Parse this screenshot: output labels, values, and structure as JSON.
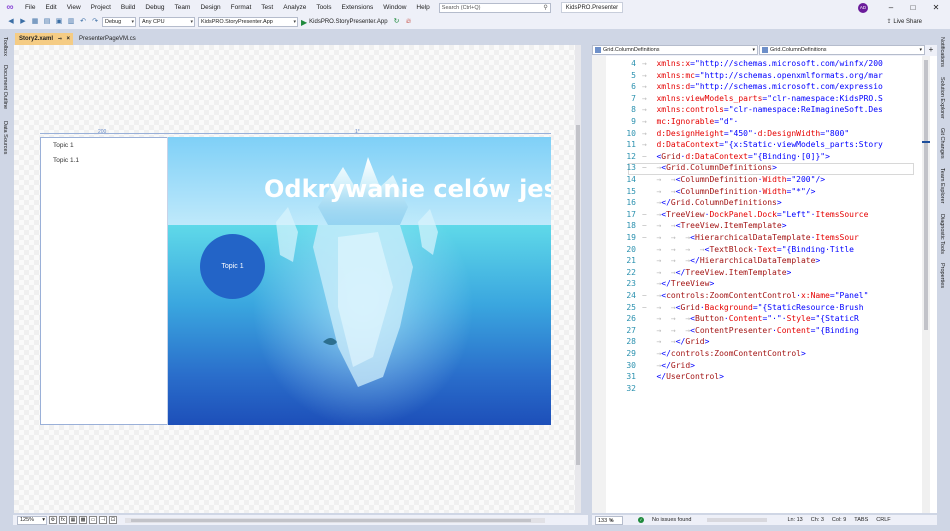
{
  "menu": {
    "items": [
      "File",
      "Edit",
      "View",
      "Project",
      "Build",
      "Debug",
      "Team",
      "Design",
      "Format",
      "Test",
      "Analyze",
      "Tools",
      "Extensions",
      "Window",
      "Help"
    ],
    "search_placeholder": "Search (Ctrl+Q)",
    "app_title": "KidsPRO.Presenter",
    "avatar_initials": "AD"
  },
  "toolbar": {
    "config": "Debug",
    "platform": "Any CPU",
    "project": "KidsPRO.StoryPresenter.App",
    "run_label": "KidsPRO.StoryPresenter.App",
    "live_share": "Live Share"
  },
  "left_dock": {
    "tabs": [
      "Toolbox",
      "Document Outline",
      "Data Sources"
    ]
  },
  "right_dock": {
    "tabs": [
      "Notifications",
      "Solution Explorer",
      "Git Changes",
      "Team Explorer",
      "Diagnostic Tools",
      "Properties"
    ]
  },
  "tabs": [
    {
      "label": "Story2.xaml",
      "active": true
    },
    {
      "label": "PresenterPageVM.cs",
      "active": false
    }
  ],
  "designer": {
    "ruler_left": "200",
    "ruler_right": "1*",
    "tree_items": [
      "Topic 1",
      "Topic 1.1"
    ],
    "headline": "Odkrywanie celów jest w",
    "circle_label": "Topic 1",
    "zoom": "125%",
    "fx": "fx"
  },
  "editor": {
    "nav_left": "Grid.ColumnDefinitions",
    "nav_right": "Grid.ColumnDefinitions",
    "lines": [
      {
        "n": "4",
        "g": "→  ",
        "parts": [
          [
            "attr",
            "xmlns:x"
          ],
          [
            "pun",
            "=\""
          ],
          [
            "str",
            "http://schemas.microsoft.com/winfx/200"
          ]
        ]
      },
      {
        "n": "5",
        "g": "→  ",
        "parts": [
          [
            "attr",
            "xmlns:mc"
          ],
          [
            "pun",
            "=\""
          ],
          [
            "str",
            "http://schemas.openxmlformats.org/mar"
          ]
        ]
      },
      {
        "n": "6",
        "g": "→  ",
        "parts": [
          [
            "attr",
            "xmlns:d"
          ],
          [
            "pun",
            "=\""
          ],
          [
            "str",
            "http://schemas.microsoft.com/expressio"
          ]
        ]
      },
      {
        "n": "7",
        "g": "→  ",
        "parts": [
          [
            "attr",
            "xmlns:viewModels_parts"
          ],
          [
            "pun",
            "=\""
          ],
          [
            "str",
            "clr-namespace:KidsPRO.S"
          ]
        ]
      },
      {
        "n": "8",
        "g": "→  ",
        "parts": [
          [
            "attr",
            "xmlns:controls"
          ],
          [
            "pun",
            "=\""
          ],
          [
            "str",
            "clr-namespace:ReImagineSoft.Des"
          ]
        ]
      },
      {
        "n": "9",
        "g": "→  ",
        "parts": [
          [
            "attr",
            "mc:Ignorable"
          ],
          [
            "pun",
            "=\""
          ],
          [
            "str",
            "d\""
          ],
          [
            "pun",
            "·"
          ]
        ]
      },
      {
        "n": "10",
        "g": "→  ",
        "parts": [
          [
            "attr",
            "d:DesignHeight"
          ],
          [
            "pun",
            "=\""
          ],
          [
            "str",
            "450\""
          ],
          [
            "pun",
            "·"
          ],
          [
            "attr",
            "d:DesignWidth"
          ],
          [
            "pun",
            "=\""
          ],
          [
            "str",
            "800\""
          ]
        ]
      },
      {
        "n": "11",
        "g": "→  ",
        "parts": [
          [
            "attr",
            "d:DataContext"
          ],
          [
            "pun",
            "=\""
          ],
          [
            "str",
            "{x:Static·viewModels_parts:Story"
          ]
        ]
      },
      {
        "n": "12",
        "g": "−  ",
        "parts": [
          [
            "pun",
            "<"
          ],
          [
            "tag",
            "Grid"
          ],
          [
            "pun",
            "·"
          ],
          [
            "attr",
            "d:DataContext"
          ],
          [
            "pun",
            "=\""
          ],
          [
            "str",
            "{Binding·[0]}"
          ],
          [
            "pun",
            "\">"
          ]
        ]
      },
      {
        "n": "13",
        "g": "−  →",
        "parts": [
          [
            "pun",
            "<"
          ],
          [
            "tag",
            "Grid.ColumnDefinitions"
          ],
          [
            "pun",
            ">"
          ]
        ]
      },
      {
        "n": "14",
        "g": "   →  →",
        "parts": [
          [
            "pun",
            "<"
          ],
          [
            "tag",
            "ColumnDefinition"
          ],
          [
            "pun",
            "·"
          ],
          [
            "attr",
            "Width"
          ],
          [
            "pun",
            "=\""
          ],
          [
            "str",
            "200"
          ],
          [
            "pun",
            "\"/>"
          ]
        ]
      },
      {
        "n": "15",
        "g": "   →  →",
        "parts": [
          [
            "pun",
            "<"
          ],
          [
            "tag",
            "ColumnDefinition"
          ],
          [
            "pun",
            "·"
          ],
          [
            "attr",
            "Width"
          ],
          [
            "pun",
            "=\""
          ],
          [
            "str",
            "*"
          ],
          [
            "pun",
            "\"/>"
          ]
        ]
      },
      {
        "n": "16",
        "g": "   →",
        "parts": [
          [
            "pun",
            "</"
          ],
          [
            "tag",
            "Grid.ColumnDefinitions"
          ],
          [
            "pun",
            ">"
          ]
        ]
      },
      {
        "n": "17",
        "g": "−  →",
        "parts": [
          [
            "pun",
            "<"
          ],
          [
            "tag",
            "TreeView"
          ],
          [
            "pun",
            "·"
          ],
          [
            "attr",
            "DockPanel.Dock"
          ],
          [
            "pun",
            "=\""
          ],
          [
            "str",
            "Left"
          ],
          [
            "pun",
            "\"·"
          ],
          [
            "attr",
            "ItemsSource"
          ]
        ]
      },
      {
        "n": "18",
        "g": "−  →  →",
        "parts": [
          [
            "pun",
            "<"
          ],
          [
            "tag",
            "TreeView.ItemTemplate"
          ],
          [
            "pun",
            ">"
          ]
        ]
      },
      {
        "n": "19",
        "g": "−  →  →  →",
        "parts": [
          [
            "pun",
            "<"
          ],
          [
            "tag",
            "HierarchicalDataTemplate"
          ],
          [
            "pun",
            "·"
          ],
          [
            "attr",
            "ItemsSour"
          ]
        ]
      },
      {
        "n": "20",
        "g": "   →  →  →  →",
        "parts": [
          [
            "pun",
            "<"
          ],
          [
            "tag",
            "TextBlock"
          ],
          [
            "pun",
            "·"
          ],
          [
            "attr",
            "Text"
          ],
          [
            "pun",
            "=\""
          ],
          [
            "str",
            "{Binding·Title"
          ]
        ]
      },
      {
        "n": "21",
        "g": "   →  →  →",
        "parts": [
          [
            "pun",
            "</"
          ],
          [
            "tag",
            "HierarchicalDataTemplate"
          ],
          [
            "pun",
            ">"
          ]
        ]
      },
      {
        "n": "22",
        "g": "   →  →",
        "parts": [
          [
            "pun",
            "</"
          ],
          [
            "tag",
            "TreeView.ItemTemplate"
          ],
          [
            "pun",
            ">"
          ]
        ]
      },
      {
        "n": "23",
        "g": "   →",
        "parts": [
          [
            "pun",
            "</"
          ],
          [
            "tag",
            "TreeView"
          ],
          [
            "pun",
            ">"
          ]
        ]
      },
      {
        "n": "24",
        "g": "−  →",
        "parts": [
          [
            "pun",
            "<"
          ],
          [
            "tag",
            "controls:ZoomContentControl"
          ],
          [
            "pun",
            "·"
          ],
          [
            "attr",
            "x:Name"
          ],
          [
            "pun",
            "=\""
          ],
          [
            "str",
            "Panel"
          ],
          [
            "pun",
            "\""
          ]
        ]
      },
      {
        "n": "25",
        "g": "−  →  →",
        "parts": [
          [
            "pun",
            "<"
          ],
          [
            "tag",
            "Grid"
          ],
          [
            "pun",
            "·"
          ],
          [
            "attr",
            "Background"
          ],
          [
            "pun",
            "=\""
          ],
          [
            "str",
            "{StaticResource·Brush"
          ]
        ]
      },
      {
        "n": "26",
        "g": "   →  →  →",
        "parts": [
          [
            "pun",
            "<"
          ],
          [
            "tag",
            "Button"
          ],
          [
            "pun",
            "·"
          ],
          [
            "attr",
            "Content"
          ],
          [
            "pun",
            "=\""
          ],
          [
            "str",
            "·"
          ],
          [
            "pun",
            "\"·"
          ],
          [
            "attr",
            "Style"
          ],
          [
            "pun",
            "=\""
          ],
          [
            "str",
            "{StaticR"
          ]
        ]
      },
      {
        "n": "27",
        "g": "   →  →  →",
        "parts": [
          [
            "pun",
            "<"
          ],
          [
            "tag",
            "ContentPresenter"
          ],
          [
            "pun",
            "·"
          ],
          [
            "attr",
            "Content"
          ],
          [
            "pun",
            "=\""
          ],
          [
            "str",
            "{Binding"
          ]
        ]
      },
      {
        "n": "28",
        "g": "   →  →",
        "parts": [
          [
            "pun",
            "</"
          ],
          [
            "tag",
            "Grid"
          ],
          [
            "pun",
            ">"
          ]
        ]
      },
      {
        "n": "29",
        "g": "   →",
        "parts": [
          [
            "pun",
            "</"
          ],
          [
            "tag",
            "controls:ZoomContentControl"
          ],
          [
            "pun",
            ">"
          ]
        ]
      },
      {
        "n": "30",
        "g": "   →",
        "parts": [
          [
            "pun",
            "</"
          ],
          [
            "tag",
            "Grid"
          ],
          [
            "pun",
            ">"
          ]
        ]
      },
      {
        "n": "31",
        "g": "   ",
        "parts": [
          [
            "pun",
            "</"
          ],
          [
            "tag",
            "UserControl"
          ],
          [
            "pun",
            ">"
          ]
        ]
      },
      {
        "n": "32",
        "g": "   ",
        "parts": []
      }
    ]
  },
  "status": {
    "zoom": "133 %",
    "issues": "No issues found",
    "line": "Ln: 13",
    "char": "Ch: 3",
    "col": "Col: 9",
    "tabs": "TABS",
    "eol": "CRLF"
  },
  "colors": {
    "accent": "#8c4bd6",
    "tab_active": "#f5cc84",
    "circle": "#2364c7"
  }
}
